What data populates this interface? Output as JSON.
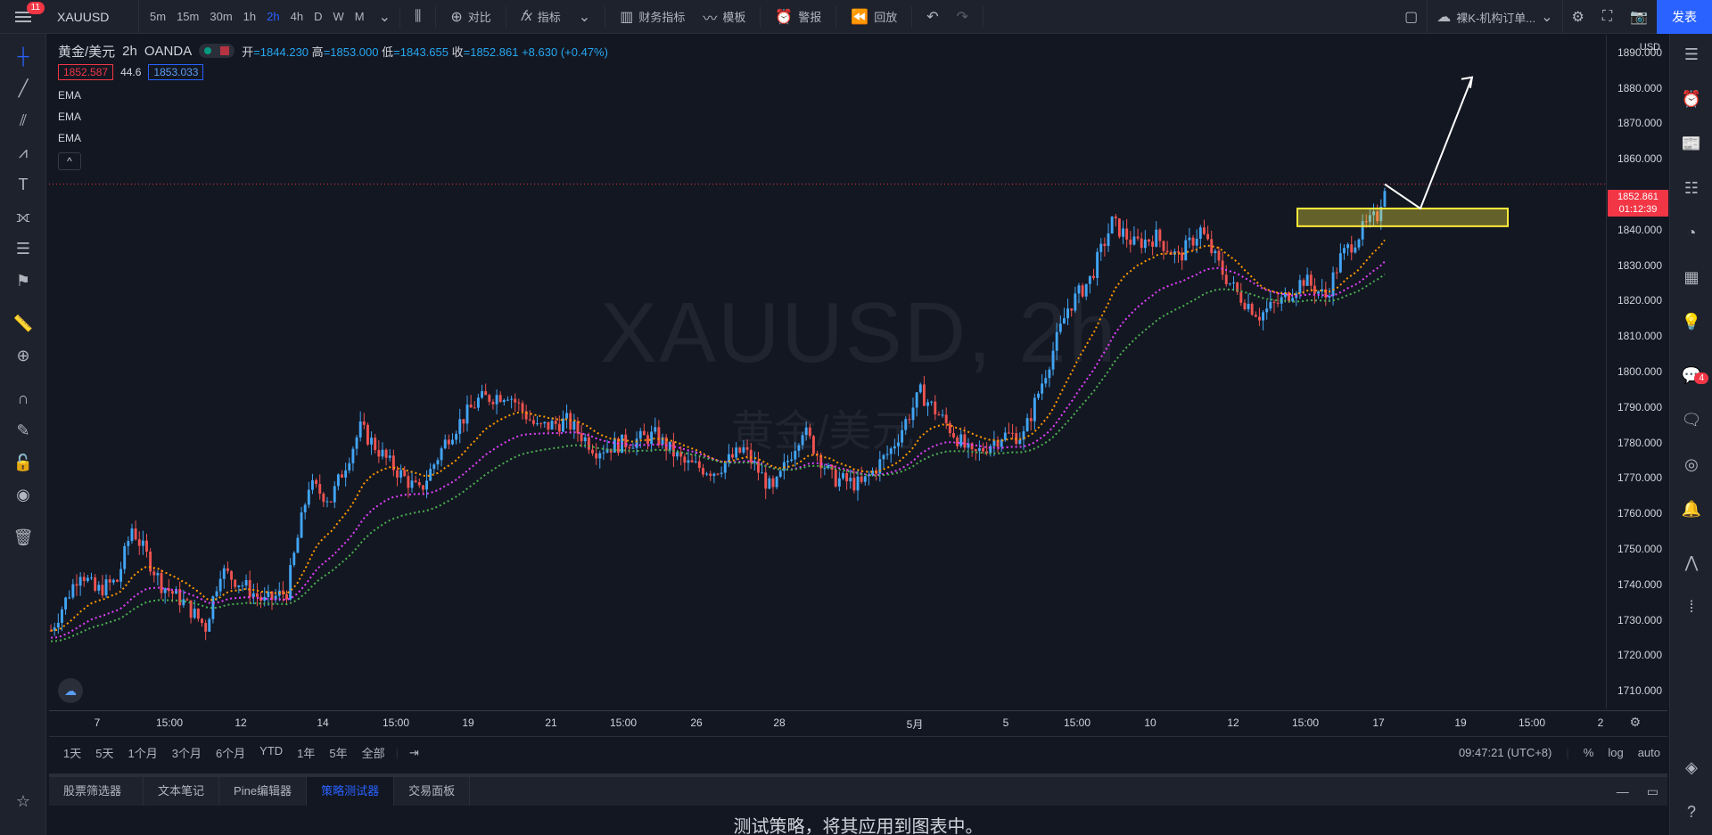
{
  "topbar": {
    "notifications": "11",
    "symbol": "XAUUSD",
    "timeframes": [
      "5m",
      "15m",
      "30m",
      "1h",
      "2h",
      "4h",
      "D",
      "W",
      "M"
    ],
    "active_timeframe": "2h",
    "compare": "对比",
    "indicators": "指标",
    "financials": "财务指标",
    "templates": "模板",
    "alert": "警报",
    "replay": "回放",
    "layout_name": "裸K-机构订单...",
    "publish": "发表"
  },
  "legend": {
    "title": "黄金/美元",
    "interval": "2h",
    "source": "OANDA",
    "open_label": "开",
    "open": "=1844.230",
    "high_label": "高",
    "high": "=1853.000",
    "low_label": "低",
    "low": "=1843.655",
    "close_label": "收",
    "close": "=1852.861",
    "change": "+8.630 (+0.47%)",
    "bid": "1852.587",
    "spread": "44.6",
    "ask": "1853.033",
    "indicators": [
      "EMA",
      "EMA",
      "EMA"
    ],
    "collapse": "^"
  },
  "watermark": {
    "main": "XAUUSD, 2h",
    "sub": "黄金/美元"
  },
  "price_axis": {
    "currency": "USD",
    "labels": [
      "1890.000",
      "1880.000",
      "1870.000",
      "1860.000",
      "1840.000",
      "1830.000",
      "1820.000",
      "1810.000",
      "1800.000",
      "1790.000",
      "1780.000",
      "1770.000",
      "1760.000",
      "1750.000",
      "1740.000",
      "1730.000",
      "1720.000",
      "1710.000"
    ],
    "current_price": "1852.861",
    "countdown": "01:12:39"
  },
  "time_axis": {
    "labels": [
      "7",
      "15:00",
      "12",
      "14",
      "15:00",
      "19",
      "21",
      "15:00",
      "26",
      "28",
      "5月",
      "5",
      "15:00",
      "10",
      "12",
      "15:00",
      "17",
      "19",
      "15:00",
      "2"
    ]
  },
  "ranges": {
    "items": [
      "1天",
      "5天",
      "1个月",
      "3个月",
      "6个月",
      "YTD",
      "1年",
      "5年",
      "全部"
    ],
    "clock": "09:47:21 (UTC+8)",
    "percent": "%",
    "log": "log",
    "auto": "auto"
  },
  "panel": {
    "tabs": [
      "股票筛选器",
      "文本笔记",
      "Pine编辑器",
      "策略测试器",
      "交易面板"
    ],
    "active_tab": "策略测试器",
    "message": "测试策略，将其应用到图表中。"
  },
  "right_badge": "4",
  "colors": {
    "up": "#42a5f5",
    "down": "#ef5350",
    "ema_fast": "#ff9800",
    "ema_mid": "#e040fb",
    "ema_slow": "#4caf50",
    "zone": "#ffeb3b"
  },
  "chart_data": {
    "type": "candlestick",
    "ylim": [
      1705,
      1895
    ],
    "current_price": 1852.861,
    "ema_last": {
      "fast": 1828,
      "mid": 1822,
      "slow": 1817
    },
    "zone": [
      1841,
      1846
    ]
  }
}
